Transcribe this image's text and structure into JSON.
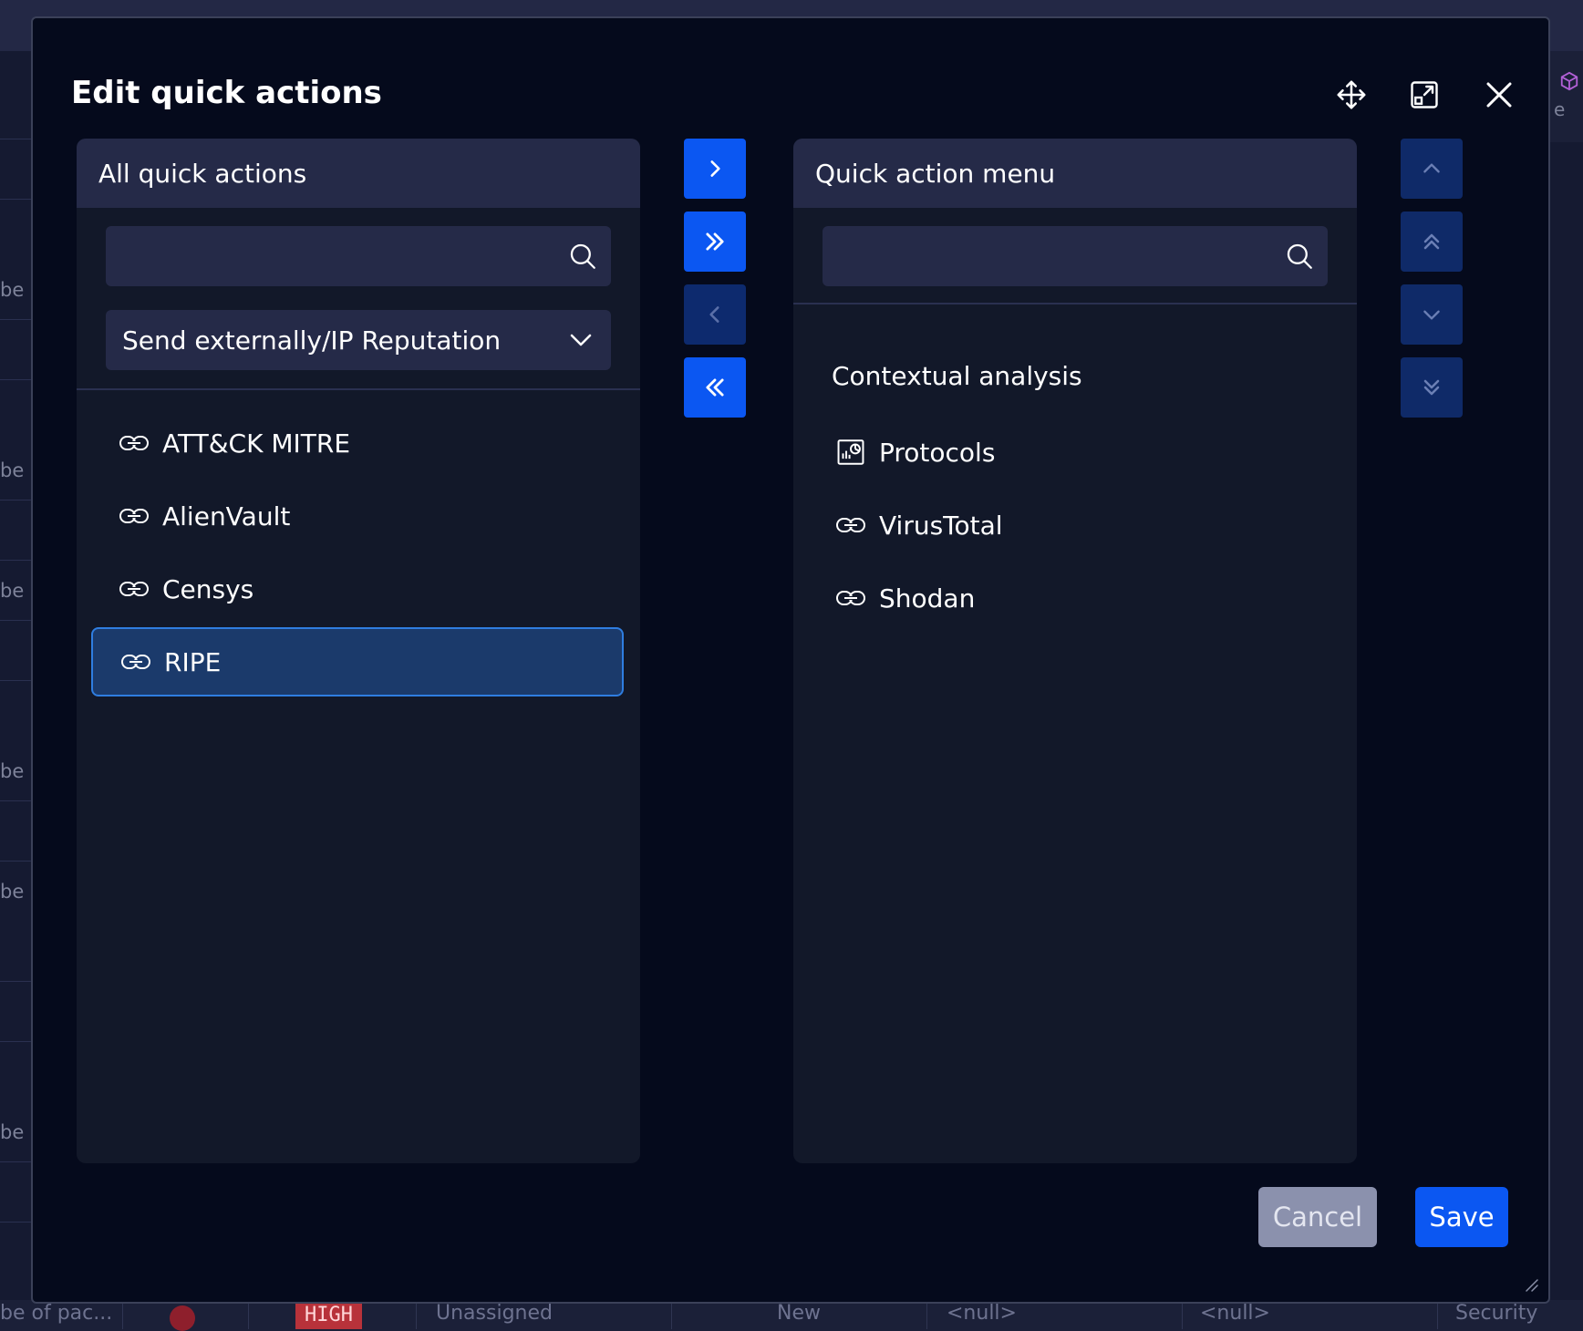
{
  "background": {
    "row_prefix": "be",
    "right_edge_text": "e",
    "bottom_row": {
      "name": "be of pac...",
      "severity": "HIGH",
      "assignee": "Unassigned",
      "status": "New",
      "null_1": "<null>",
      "null_2": "<null>",
      "category": "Security"
    }
  },
  "modal": {
    "title": "Edit quick actions",
    "header_icons": [
      "move-icon",
      "popout-icon",
      "close-icon"
    ]
  },
  "left_panel": {
    "heading": "All quick actions",
    "search_value": "",
    "category_select": "Send externally/IP Reputation",
    "items": [
      {
        "label": "ATT&CK MITRE",
        "icon": "link-icon",
        "selected": false
      },
      {
        "label": "AlienVault",
        "icon": "link-icon",
        "selected": false
      },
      {
        "label": "Censys",
        "icon": "link-icon",
        "selected": false
      },
      {
        "label": "RIPE",
        "icon": "link-icon",
        "selected": true
      }
    ]
  },
  "transfer_buttons": [
    "move-right-icon",
    "move-all-right-icon",
    "move-left-icon",
    "move-all-left-icon"
  ],
  "right_panel": {
    "heading": "Quick action menu",
    "search_value": "",
    "group_label": "Contextual analysis",
    "items": [
      {
        "label": "Protocols",
        "icon": "chart-icon"
      },
      {
        "label": "VirusTotal",
        "icon": "link-icon"
      },
      {
        "label": "Shodan",
        "icon": "link-icon"
      }
    ]
  },
  "order_buttons": [
    "move-up-icon",
    "move-top-icon",
    "move-down-icon",
    "move-bottom-icon"
  ],
  "footer": {
    "cancel_label": "Cancel",
    "save_label": "Save"
  },
  "colors": {
    "accent": "#0b57f2",
    "modal_bg": "#050a1c",
    "panel_bg": "#121829",
    "panel_header": "#252a48",
    "selected_bg": "#1b3a6b",
    "selected_border": "#2f7de0",
    "severity_high": "#b8323a"
  }
}
